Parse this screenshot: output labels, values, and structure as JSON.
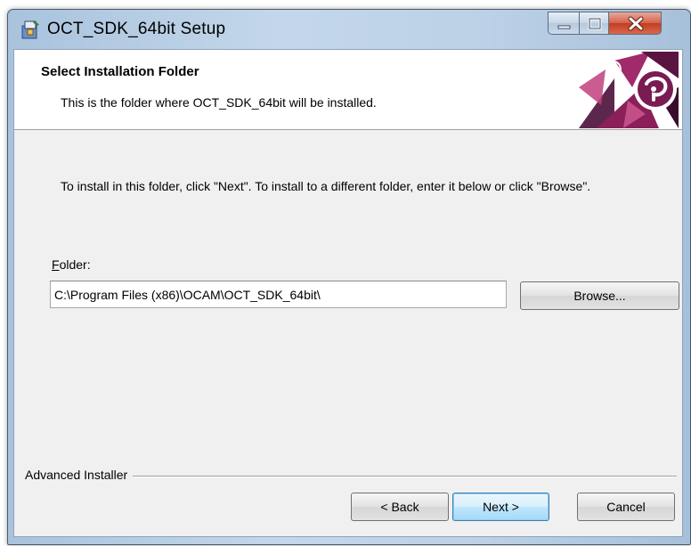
{
  "window": {
    "title": "OCT_SDK_64bit Setup"
  },
  "banner": {
    "title": "Select Installation Folder",
    "subtitle": "This is the folder where OCT_SDK_64bit will be installed."
  },
  "content": {
    "instruction": "To install in this folder, click \"Next\". To install to a different folder, enter it below or click \"Browse\".",
    "folder_label_hotkey": "F",
    "folder_label_rest": "older:",
    "folder_value": "C:\\Program Files (x86)\\OCAM\\OCT_SDK_64bit\\",
    "browse_label": "Browse..."
  },
  "footer": {
    "brand": "Advanced Installer",
    "back_label": "< Back",
    "next_label": "Next >",
    "cancel_label": "Cancel"
  },
  "icons": {
    "app": "installer-package-icon",
    "logo": "advanced-installer-logo",
    "minimize": "minimize-icon",
    "maximize": "maximize-icon",
    "close": "close-icon"
  },
  "colors": {
    "titlebar": "#bcd1e6",
    "close_button": "#c23e22",
    "default_button": "#bee6fd",
    "logo_primary": "#8a1f5a"
  }
}
